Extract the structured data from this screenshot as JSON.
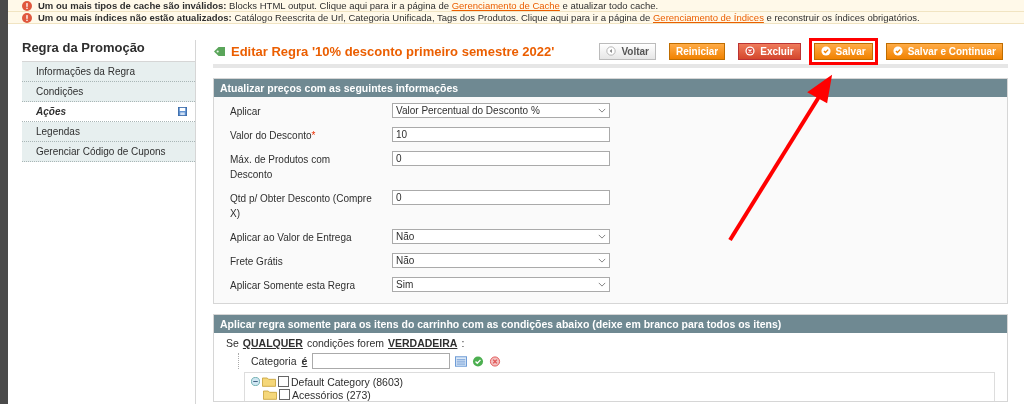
{
  "notices": [
    {
      "bold": "Um ou mais tipos de cache são inválidos:",
      "text": " Blocks HTML output. Clique aqui para ir a página de ",
      "link": "Gerenciamento de Cache",
      "after": " e atualizar todo cache."
    },
    {
      "bold": "Um ou mais índices não estão atualizados:",
      "text": " Catálogo Reescrita de Url, Categoria Unificada, Tags dos Produtos. Clique aqui para ir a página de ",
      "link": "Gerenciamento de Índices",
      "after": " e reconstruir os índices obrigatórios."
    }
  ],
  "sidebar": {
    "title": "Regra da Promoção",
    "items": [
      {
        "label": "Informações da Regra",
        "selected": false,
        "changed": false
      },
      {
        "label": "Condições",
        "selected": false,
        "changed": false
      },
      {
        "label": "Ações",
        "selected": true,
        "changed": true
      },
      {
        "label": "Legendas",
        "selected": false,
        "changed": false
      },
      {
        "label": "Gerenciar Código de Cupons",
        "selected": false,
        "changed": false
      }
    ]
  },
  "page_title": "Editar Regra '10% desconto primeiro semestre 2022'",
  "buttons": [
    {
      "label": "Voltar",
      "kind": "back",
      "highlighted": false
    },
    {
      "label": "Reiniciar",
      "kind": "plain",
      "highlighted": false
    },
    {
      "label": "Excluir",
      "kind": "delete",
      "highlighted": false
    },
    {
      "label": "Salvar",
      "kind": "save",
      "highlighted": true
    },
    {
      "label": "Salvar e Continuar",
      "kind": "save",
      "highlighted": false
    }
  ],
  "actions_section": {
    "title": "Atualizar preços com as seguintes informações",
    "fields": [
      {
        "label": "Aplicar",
        "kind": "select",
        "value": "Valor Percentual do Desconto %"
      },
      {
        "label": "Valor do Desconto",
        "kind": "input",
        "value": "10",
        "required_mark": "*"
      },
      {
        "label": "Máx. de Produtos com Desconto",
        "kind": "input",
        "value": "0"
      },
      {
        "label": "Qtd p/ Obter Desconto (Compre X)",
        "kind": "input",
        "value": "0"
      },
      {
        "label": "Aplicar ao Valor de Entrega",
        "kind": "select",
        "value": "Não"
      },
      {
        "label": "Frete Grátis",
        "kind": "select",
        "value": "Não"
      },
      {
        "label": "Aplicar Somente esta Regra",
        "kind": "select",
        "value": "Sim"
      }
    ]
  },
  "conditions_section": {
    "title": "Aplicar regra somente para os itens do carrinho com as condições abaixo (deixe em branco para todos os itens)",
    "sentence": {
      "prefix": "Se",
      "aggregator": "QUALQUER",
      "middle": "condições forem",
      "value": "VERDADEIRA",
      "suffix": ":"
    },
    "condition": {
      "attribute": "Categoria",
      "operator": "é"
    },
    "tree": [
      {
        "label": "Default Category (8603)",
        "checked": false,
        "expanded": true,
        "children": [
          {
            "label": "Acessórios (273)",
            "checked": false
          }
        ]
      }
    ]
  }
}
